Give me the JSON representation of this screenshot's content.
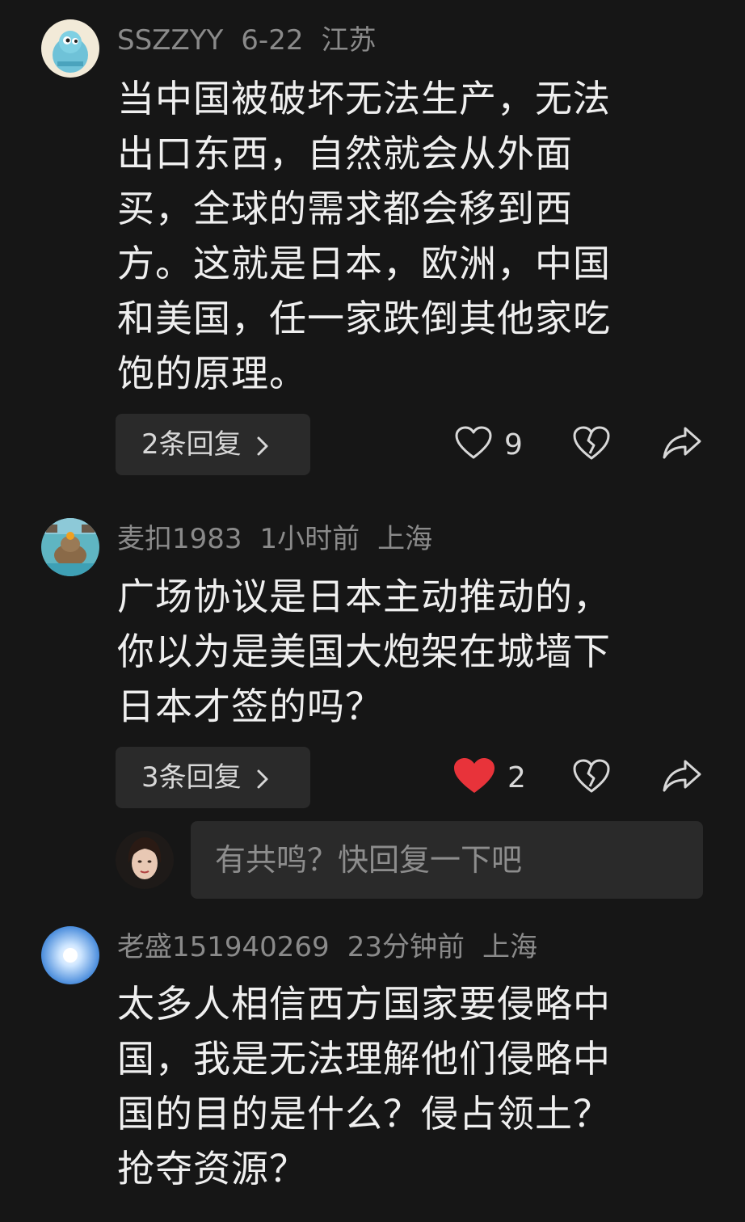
{
  "comments": [
    {
      "user": "SSZZYY",
      "time": "6-22",
      "location": "江苏",
      "lines": [
        "当中国被破坏无法生产，无法",
        "出口东西，自然就会从外面",
        "买，全球的需求都会移到西",
        "方。这就是日本，欧洲，中国",
        "和美国，任一家跌倒其他家吃",
        "饱的原理。"
      ],
      "replies_label": "2条回复",
      "likes": "9",
      "liked": false
    },
    {
      "user": "麦扣1983",
      "time": "1小时前",
      "location": "上海",
      "lines": [
        "广场协议是日本主动推动的，",
        "你以为是美国大炮架在城墙下",
        "日本才签的吗？"
      ],
      "replies_label": "3条回复",
      "likes": "2",
      "liked": true
    },
    {
      "user": "老盛151940269",
      "time": "23分钟前",
      "location": "上海",
      "lines": [
        "太多人相信西方国家要侵略中",
        "国，我是无法理解他们侵略中",
        "国的目的是什么？侵占领土？",
        "抢夺资源？"
      ]
    }
  ],
  "reply_input": {
    "placeholder": "有共鸣？快回复一下吧"
  },
  "icons": {
    "like": "heart-outline-icon",
    "liked": "heart-filled-icon",
    "dislike": "broken-heart-icon",
    "share": "share-arrow-icon",
    "chevron": "chevron-right-icon"
  },
  "colors": {
    "background": "#161616",
    "like_active": "#e8333a",
    "secondary_text": "#8a8a8a",
    "button_bg": "#2a2a2a"
  }
}
